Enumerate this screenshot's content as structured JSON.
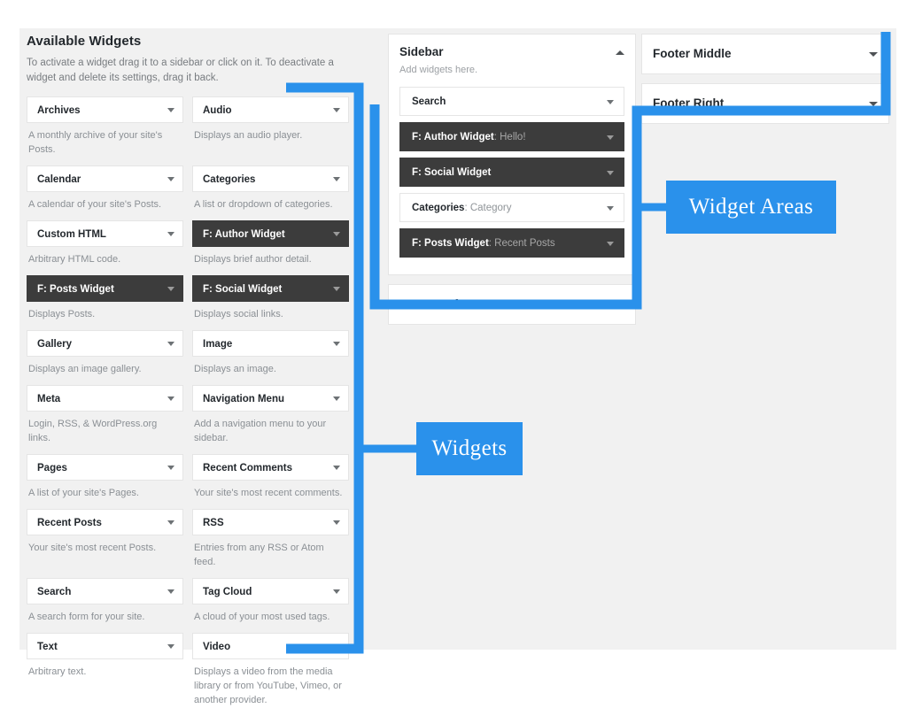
{
  "available": {
    "title": "Available Widgets",
    "description": "To activate a widget drag it to a sidebar or click on it. To deactivate a widget and delete its settings, drag it back.",
    "widgets": [
      {
        "name": "Archives",
        "desc": "A monthly archive of your site's Posts.",
        "active": false
      },
      {
        "name": "Audio",
        "desc": "Displays an audio player.",
        "active": false
      },
      {
        "name": "Calendar",
        "desc": "A calendar of your site's Posts.",
        "active": false
      },
      {
        "name": "Categories",
        "desc": "A list or dropdown of categories.",
        "active": false
      },
      {
        "name": "Custom HTML",
        "desc": "Arbitrary HTML code.",
        "active": false
      },
      {
        "name": "F: Author Widget",
        "desc": "Displays brief author detail.",
        "active": true
      },
      {
        "name": "F: Posts Widget",
        "desc": "Displays Posts.",
        "active": true
      },
      {
        "name": "F: Social Widget",
        "desc": "Displays social links.",
        "active": true
      },
      {
        "name": "Gallery",
        "desc": "Displays an image gallery.",
        "active": false
      },
      {
        "name": "Image",
        "desc": "Displays an image.",
        "active": false
      },
      {
        "name": "Meta",
        "desc": "Login, RSS, & WordPress.org links.",
        "active": false
      },
      {
        "name": "Navigation Menu",
        "desc": "Add a navigation menu to your sidebar.",
        "active": false
      },
      {
        "name": "Pages",
        "desc": "A list of your site's Pages.",
        "active": false
      },
      {
        "name": "Recent Comments",
        "desc": "Your site's most recent comments.",
        "active": false
      },
      {
        "name": "Recent Posts",
        "desc": "Your site's most recent Posts.",
        "active": false
      },
      {
        "name": "RSS",
        "desc": "Entries from any RSS or Atom feed.",
        "active": false
      },
      {
        "name": "Search",
        "desc": "A search form for your site.",
        "active": false
      },
      {
        "name": "Tag Cloud",
        "desc": "A cloud of your most used tags.",
        "active": false
      },
      {
        "name": "Text",
        "desc": "Arbitrary text.",
        "active": false
      },
      {
        "name": "Video",
        "desc": "Displays a video from the media library or from YouTube, Vimeo, or another provider.",
        "active": false
      }
    ]
  },
  "sidebar_area": {
    "name": "Sidebar",
    "sub": "Add widgets here.",
    "expanded": true,
    "items": [
      {
        "name": "Search",
        "value": "",
        "active": false
      },
      {
        "name": "F: Author Widget",
        "value": "Hello!",
        "active": true
      },
      {
        "name": "F: Social Widget",
        "value": "",
        "active": true
      },
      {
        "name": "Categories",
        "value": "Category",
        "active": false
      },
      {
        "name": "F: Posts Widget",
        "value": "Recent Posts",
        "active": true
      }
    ]
  },
  "other_areas": [
    {
      "name": "Footer Left",
      "expanded": false
    },
    {
      "name": "Footer Middle",
      "expanded": false
    },
    {
      "name": "Footer Right",
      "expanded": false
    }
  ],
  "annotations": {
    "widgets_label": "Widgets",
    "widget_areas_label": "Widget Areas",
    "accent_color": "#2a91eb"
  }
}
